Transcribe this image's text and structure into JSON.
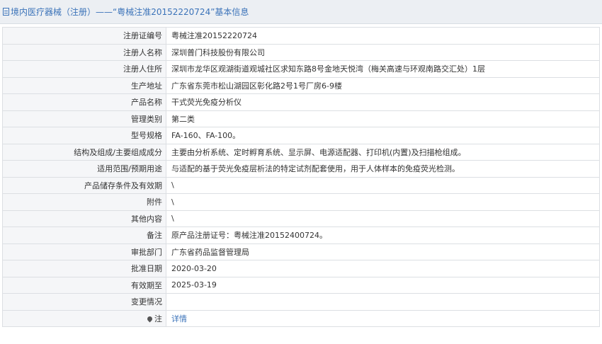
{
  "header": {
    "title": "境内医疗器械（注册）——“粤械注准20152220724”基本信息"
  },
  "rows": [
    {
      "label": "注册证编号",
      "value": "粤械注准20152220724"
    },
    {
      "label": "注册人名称",
      "value": "深圳普门科技股份有限公司"
    },
    {
      "label": "注册人住所",
      "value": "深圳市龙华区观湖街道观城社区求知东路8号金地天悦湾（梅关高速与环观南路交汇处）1层"
    },
    {
      "label": "生产地址",
      "value": "广东省东莞市松山湖园区彰化路2号1号厂房6-9楼"
    },
    {
      "label": "产品名称",
      "value": "干式荧光免疫分析仪"
    },
    {
      "label": "管理类别",
      "value": "第二类"
    },
    {
      "label": "型号规格",
      "value": "FA-160、FA-100。"
    },
    {
      "label": "结构及组成/主要组成成分",
      "value": "主要由分析系统、定时孵育系统、显示屏、电源适配器、打印机(内置)及扫描枪组成。"
    },
    {
      "label": "适用范围/预期用途",
      "value": "与适配的基于荧光免疫层析法的特定试剂配套使用，用于人体样本的免疫荧光检测。"
    },
    {
      "label": "产品储存条件及有效期",
      "value": "\\"
    },
    {
      "label": "附件",
      "value": "\\"
    },
    {
      "label": "其他内容",
      "value": "\\"
    },
    {
      "label": "备注",
      "value": "原产品注册证号：粤械注准20152400724。"
    },
    {
      "label": "审批部门",
      "value": "广东省药品监督管理局"
    },
    {
      "label": "批准日期",
      "value": "2020-03-20"
    },
    {
      "label": "有效期至",
      "value": "2025-03-19"
    },
    {
      "label": "变更情况",
      "value": ""
    }
  ],
  "note": {
    "label": "注",
    "icon": "pin-icon",
    "link_text": "详情"
  }
}
